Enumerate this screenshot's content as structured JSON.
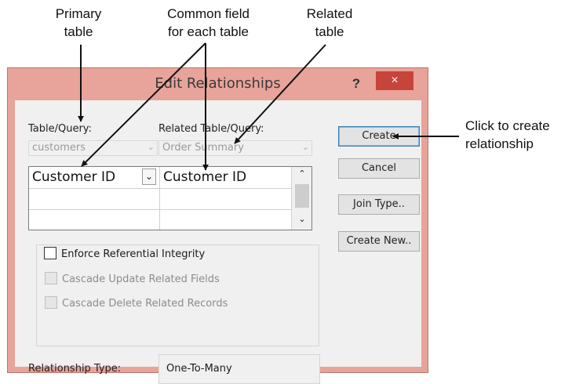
{
  "callouts": {
    "primary_table": [
      "Primary",
      "table"
    ],
    "common_field": [
      "Common field",
      "for each table"
    ],
    "related_table": [
      "Related",
      "table"
    ],
    "click_create": [
      "Click to create",
      "relationship"
    ]
  },
  "dialog": {
    "title": "Edit Relationships",
    "help_label": "?",
    "close_label": "×",
    "table_query_label": "Table/Query:",
    "related_table_query_label": "Related Table/Query:",
    "table_query_value": "customers",
    "related_table_query_value": "Order Summary",
    "grid_rows": [
      {
        "primary_field": "Customer ID",
        "related_field": "Customer ID"
      },
      {
        "primary_field": "",
        "related_field": ""
      },
      {
        "primary_field": "",
        "related_field": ""
      }
    ],
    "buttons": {
      "create": "Create",
      "cancel": "Cancel",
      "join_type": "Join Type..",
      "create_new": "Create New.."
    },
    "options": {
      "enforce_integrity": {
        "label": "Enforce Referential Integrity",
        "checked": false,
        "enabled": true
      },
      "cascade_update": {
        "label": "Cascade Update Related Fields",
        "checked": false,
        "enabled": false
      },
      "cascade_delete": {
        "label": "Cascade Delete Related Records",
        "checked": false,
        "enabled": false
      }
    },
    "relationship_type_label": "Relationship Type:",
    "relationship_type_value": "One-To-Many"
  },
  "colors": {
    "title_bar": "#e8a39a",
    "close_button": "#c7443a",
    "dialog_body": "#f0f0f0"
  },
  "icons": {
    "dropdown": "chevron-down-icon",
    "scroll_up": "chevron-up-icon",
    "scroll_down": "chevron-down-icon",
    "help": "help-icon",
    "close": "close-icon"
  }
}
